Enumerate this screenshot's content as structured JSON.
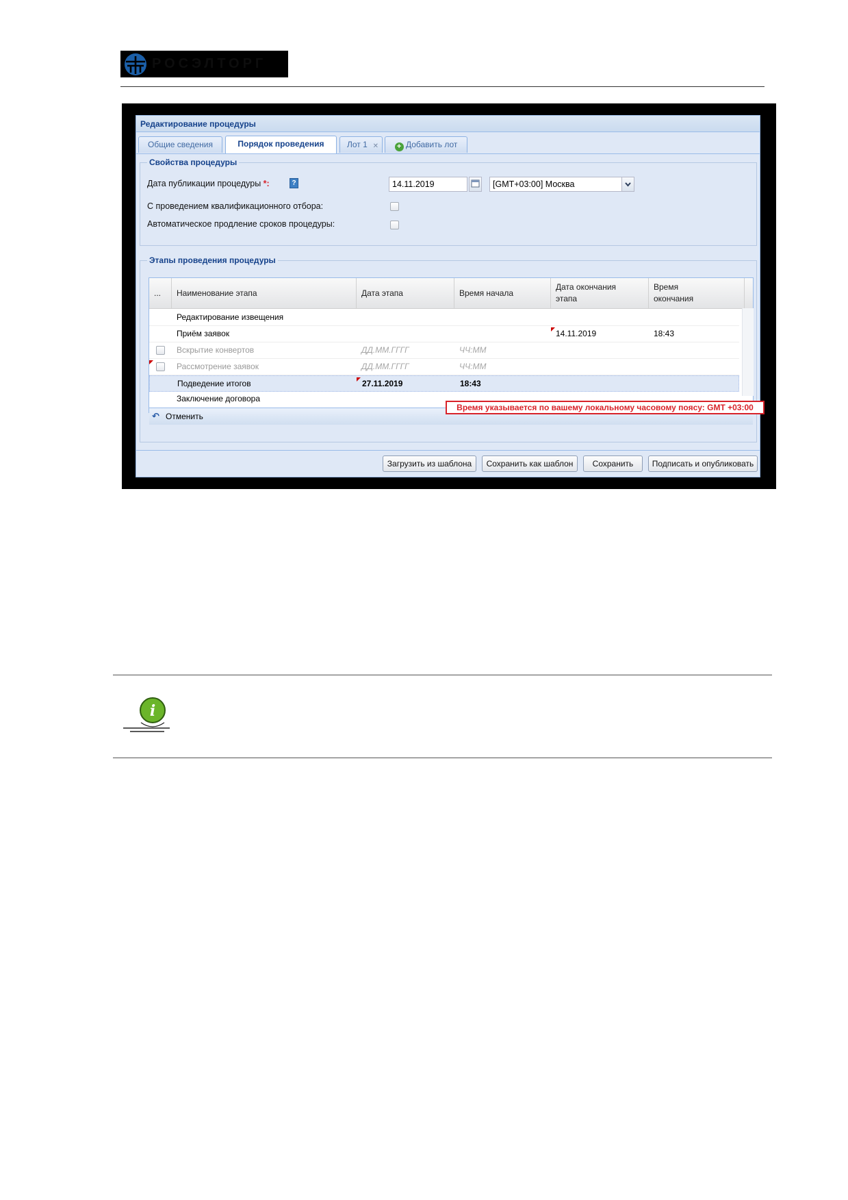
{
  "doc": {
    "logo_text": "РОСЭЛТОРГ"
  },
  "window": {
    "title": "Редактирование процедуры",
    "tabs": [
      {
        "label": "Общие сведения"
      },
      {
        "label": "Порядок проведения"
      },
      {
        "label": "Лот 1"
      },
      {
        "label": "Добавить лот"
      }
    ],
    "props": {
      "legend": "Свойства процедуры",
      "pub_date_label": "Дата публикации процедуры",
      "required_mark": "*:",
      "pub_date_value": "14.11.2019",
      "timezone_value": "[GMT+03:00] Москва",
      "qualification_label": "С проведением квалификационного отбора:",
      "auto_extend_label": "Автоматическое продление сроков процедуры:"
    },
    "stages": {
      "legend": "Этапы проведения процедуры",
      "columns": {
        "menu": "...",
        "name": "Наименование этапа",
        "date": "Дата этапа",
        "start_time": "Время начала",
        "end_date": "Дата окончания этапа",
        "end_time": "Время окончания"
      },
      "rows": [
        {
          "name": "Редактирование извещения",
          "date": "",
          "start": "",
          "end_date": "",
          "end_time": ""
        },
        {
          "name": "Приём заявок",
          "date": "",
          "start": "",
          "end_date": "14.11.2019",
          "end_time": "18:43"
        },
        {
          "name": "Вскрытие конвертов",
          "date": "ДД.ММ.ГГГГ",
          "start": "ЧЧ:ММ",
          "end_date": "",
          "end_time": ""
        },
        {
          "name": "Рассмотрение заявок",
          "date": "ДД.ММ.ГГГГ",
          "start": "ЧЧ:ММ",
          "end_date": "",
          "end_time": ""
        },
        {
          "name": "Подведение итогов",
          "date": "27.11.2019",
          "start": "18:43",
          "end_date": "",
          "end_time": ""
        },
        {
          "name": "Заключение договора",
          "date": "",
          "start": "",
          "end_date": "",
          "end_time": ""
        }
      ],
      "cancel_label": "Отменить",
      "timezone_notice": "Время указывается по вашему локальному часовому поясу: GMT +03:00"
    },
    "buttons": {
      "load_template": "Загрузить из шаблона",
      "save_template": "Сохранить как шаблон",
      "save": "Сохранить",
      "sign_publish": "Подписать и опубликовать"
    }
  },
  "icons": {
    "calendar": "calendar-icon",
    "help": "help-icon",
    "tab_close": "close-icon",
    "add": "add-icon",
    "undo": "undo-icon",
    "info": "info-icon"
  },
  "colors": {
    "accent": "#15428b",
    "notice": "#d8232a",
    "info_green": "#6bb52a"
  }
}
